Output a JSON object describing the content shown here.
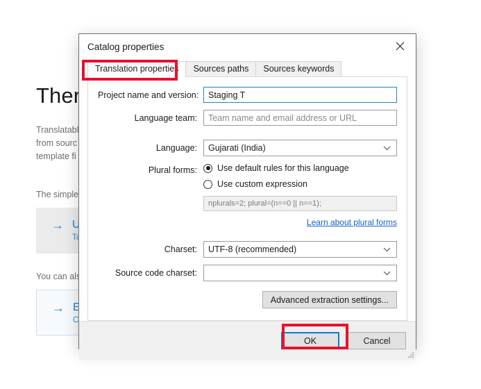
{
  "background": {
    "title": "There",
    "description_lines": [
      "Translatable",
      "from sourc",
      "template fi"
    ],
    "sub_text": "The simple",
    "primary_card": {
      "arrow": "→",
      "title": "Upd",
      "subtitle": "Take"
    },
    "also_text": "You can als",
    "secondary_card": {
      "arrow": "→",
      "title": "Extr",
      "subtitle": "Con"
    }
  },
  "dialog": {
    "title": "Catalog properties",
    "close_icon": "close-icon",
    "tabs": [
      {
        "label": "Translation properties",
        "active": true
      },
      {
        "label": "Sources paths",
        "active": false
      },
      {
        "label": "Sources keywords",
        "active": false
      }
    ],
    "fields": {
      "project_name": {
        "label": "Project name and version:",
        "value": "Staging T",
        "placeholder": "",
        "focused": true
      },
      "language_team": {
        "label": "Language team:",
        "value": "",
        "placeholder": "Team name and email address or URL",
        "focused": false
      },
      "language": {
        "label": "Language:",
        "value": "Gujarati (India)",
        "chevron": "⌄"
      },
      "plural_forms": {
        "label": "Plural forms:",
        "option_default": "Use default rules for this language",
        "option_custom": "Use custom expression",
        "selected": "default",
        "expression": "nplurals=2; plural=(n==0 || n==1);",
        "help_link": "Learn about plural forms"
      },
      "charset": {
        "label": "Charset:",
        "value": "UTF-8 (recommended)",
        "chevron": "⌄"
      },
      "source_code_charset": {
        "label": "Source code charset:",
        "value": "",
        "chevron": "⌄"
      }
    },
    "advanced_button": "Advanced extraction settings...",
    "footer": {
      "ok": "OK",
      "cancel": "Cancel"
    }
  },
  "annotations": {
    "accent_color": "#e8112d",
    "focus_color": "#0a7cc8",
    "items": [
      {
        "name": "translation-properties-tab-highlight"
      },
      {
        "name": "ok-button-highlight"
      }
    ]
  }
}
